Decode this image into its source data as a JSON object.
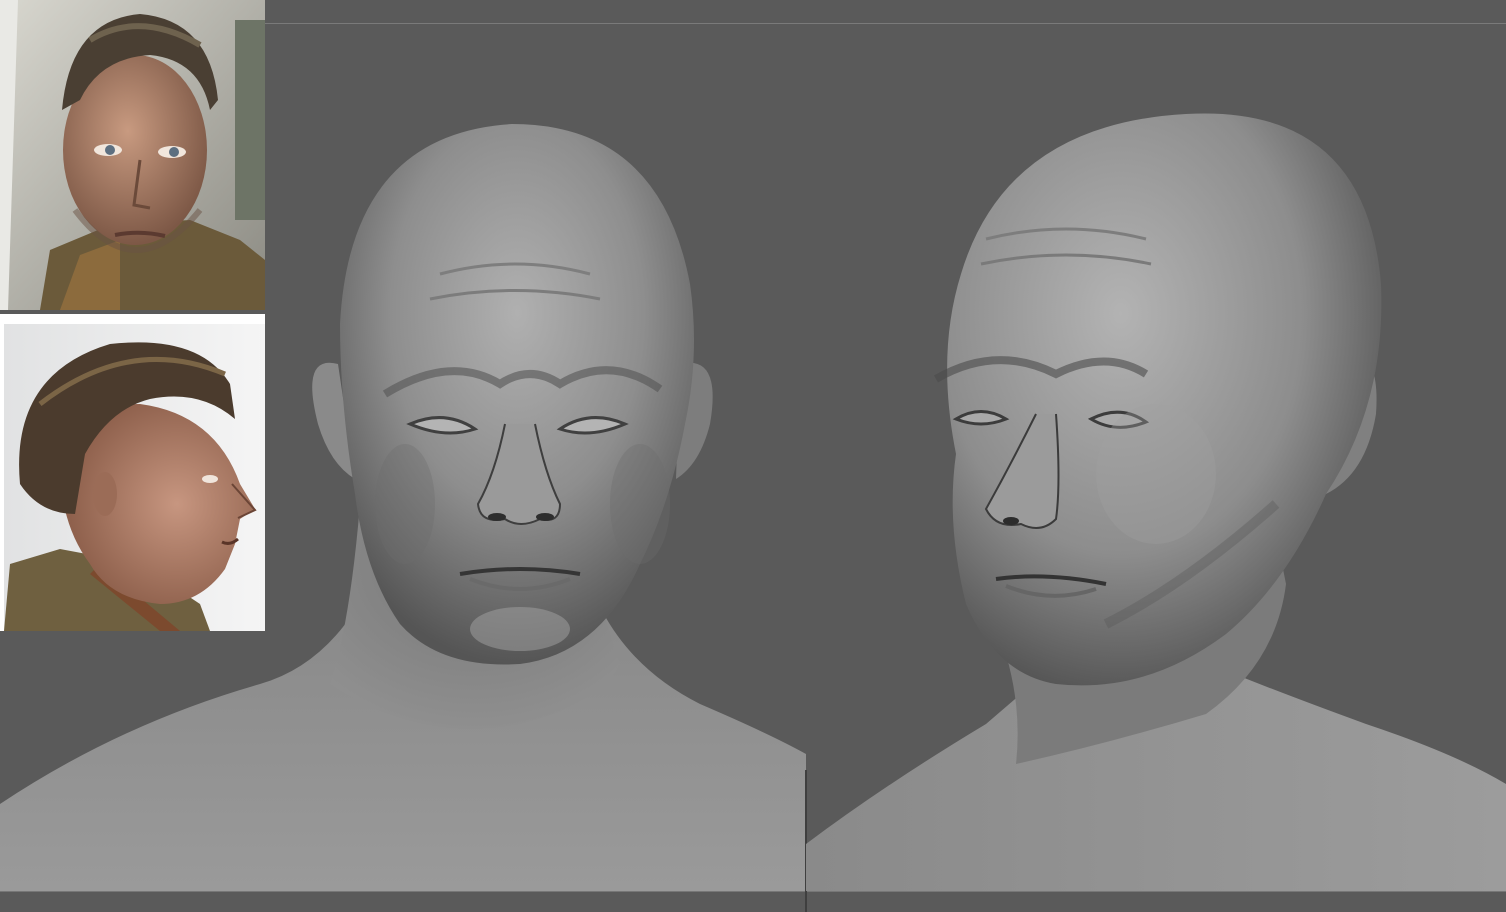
{
  "app": {
    "canvas_background": "#5a5a5a",
    "clay_color": "#8f8f8f"
  },
  "reference_images": [
    {
      "name": "front-reference",
      "view": "front"
    },
    {
      "name": "side-reference",
      "view": "profile"
    }
  ],
  "viewports": [
    {
      "name": "front-view-sculpt",
      "view": "front"
    },
    {
      "name": "three-quarter-view-sculpt",
      "view": "three-quarter"
    }
  ]
}
